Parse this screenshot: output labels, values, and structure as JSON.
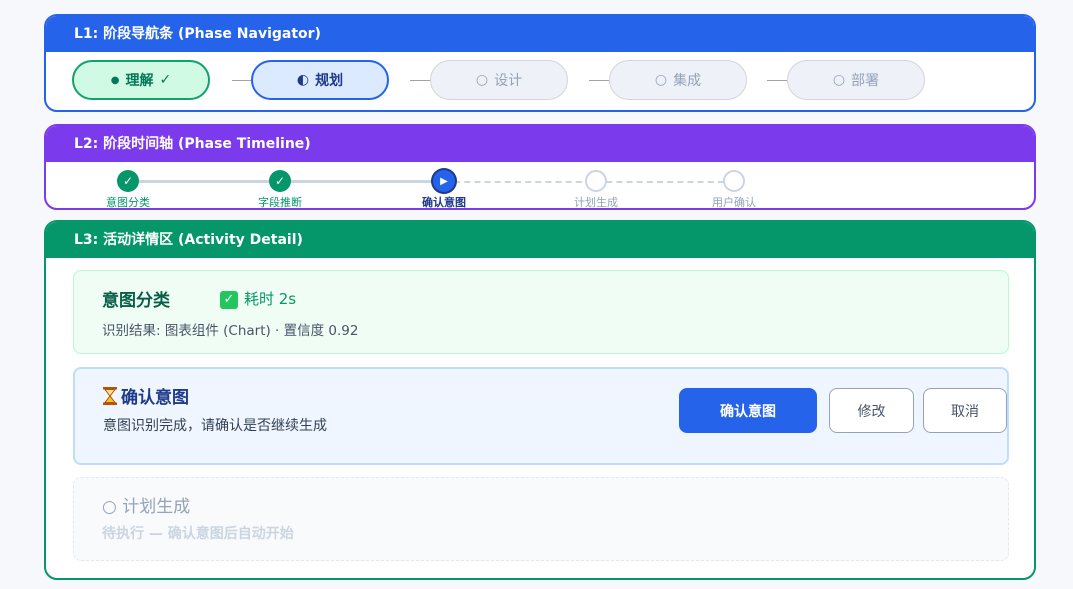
{
  "l1": {
    "title": "L1: 阶段导航条 (Phase Navigator)",
    "phases": [
      {
        "icon": "●",
        "label": "理解",
        "suffix": "✓",
        "state": "done"
      },
      {
        "icon": "◐",
        "label": "规划",
        "suffix": "",
        "state": "active"
      },
      {
        "icon": "○",
        "label": "设计",
        "suffix": "",
        "state": "pending"
      },
      {
        "icon": "○",
        "label": "集成",
        "suffix": "",
        "state": "pending"
      },
      {
        "icon": "○",
        "label": "部署",
        "suffix": "",
        "state": "pending"
      }
    ]
  },
  "l2": {
    "title": "L2: 阶段时间轴 (Phase Timeline)",
    "steps": [
      {
        "label": "意图分类",
        "state": "done",
        "icon": "✓"
      },
      {
        "label": "字段推断",
        "state": "done",
        "icon": "✓"
      },
      {
        "label": "确认意图",
        "state": "current",
        "icon": "▶"
      },
      {
        "label": "计划生成",
        "state": "pending",
        "icon": ""
      },
      {
        "label": "用户确认",
        "state": "pending",
        "icon": ""
      }
    ]
  },
  "l3": {
    "title": "L3: 活动详情区 (Activity Detail)",
    "done_card": {
      "title": "意图分类",
      "badge_icon": "✓",
      "duration": "耗时 2s",
      "result": "识别结果: 图表组件 (Chart) · 置信度 0.92"
    },
    "active_card": {
      "title": "确认意图",
      "desc": "意图识别完成，请确认是否继续生成",
      "confirm_label": "确认意图",
      "modify_label": "修改",
      "cancel_label": "取消"
    },
    "pending_card": {
      "icon": "○",
      "title": "计划生成",
      "desc": "待执行 — 确认意图后自动开始"
    }
  },
  "colors": {
    "l1": "#2563eb",
    "l2": "#7c3aed",
    "l3": "#059669",
    "done": "#059669",
    "active": "#2563eb",
    "pending": "#cbd5e1"
  }
}
